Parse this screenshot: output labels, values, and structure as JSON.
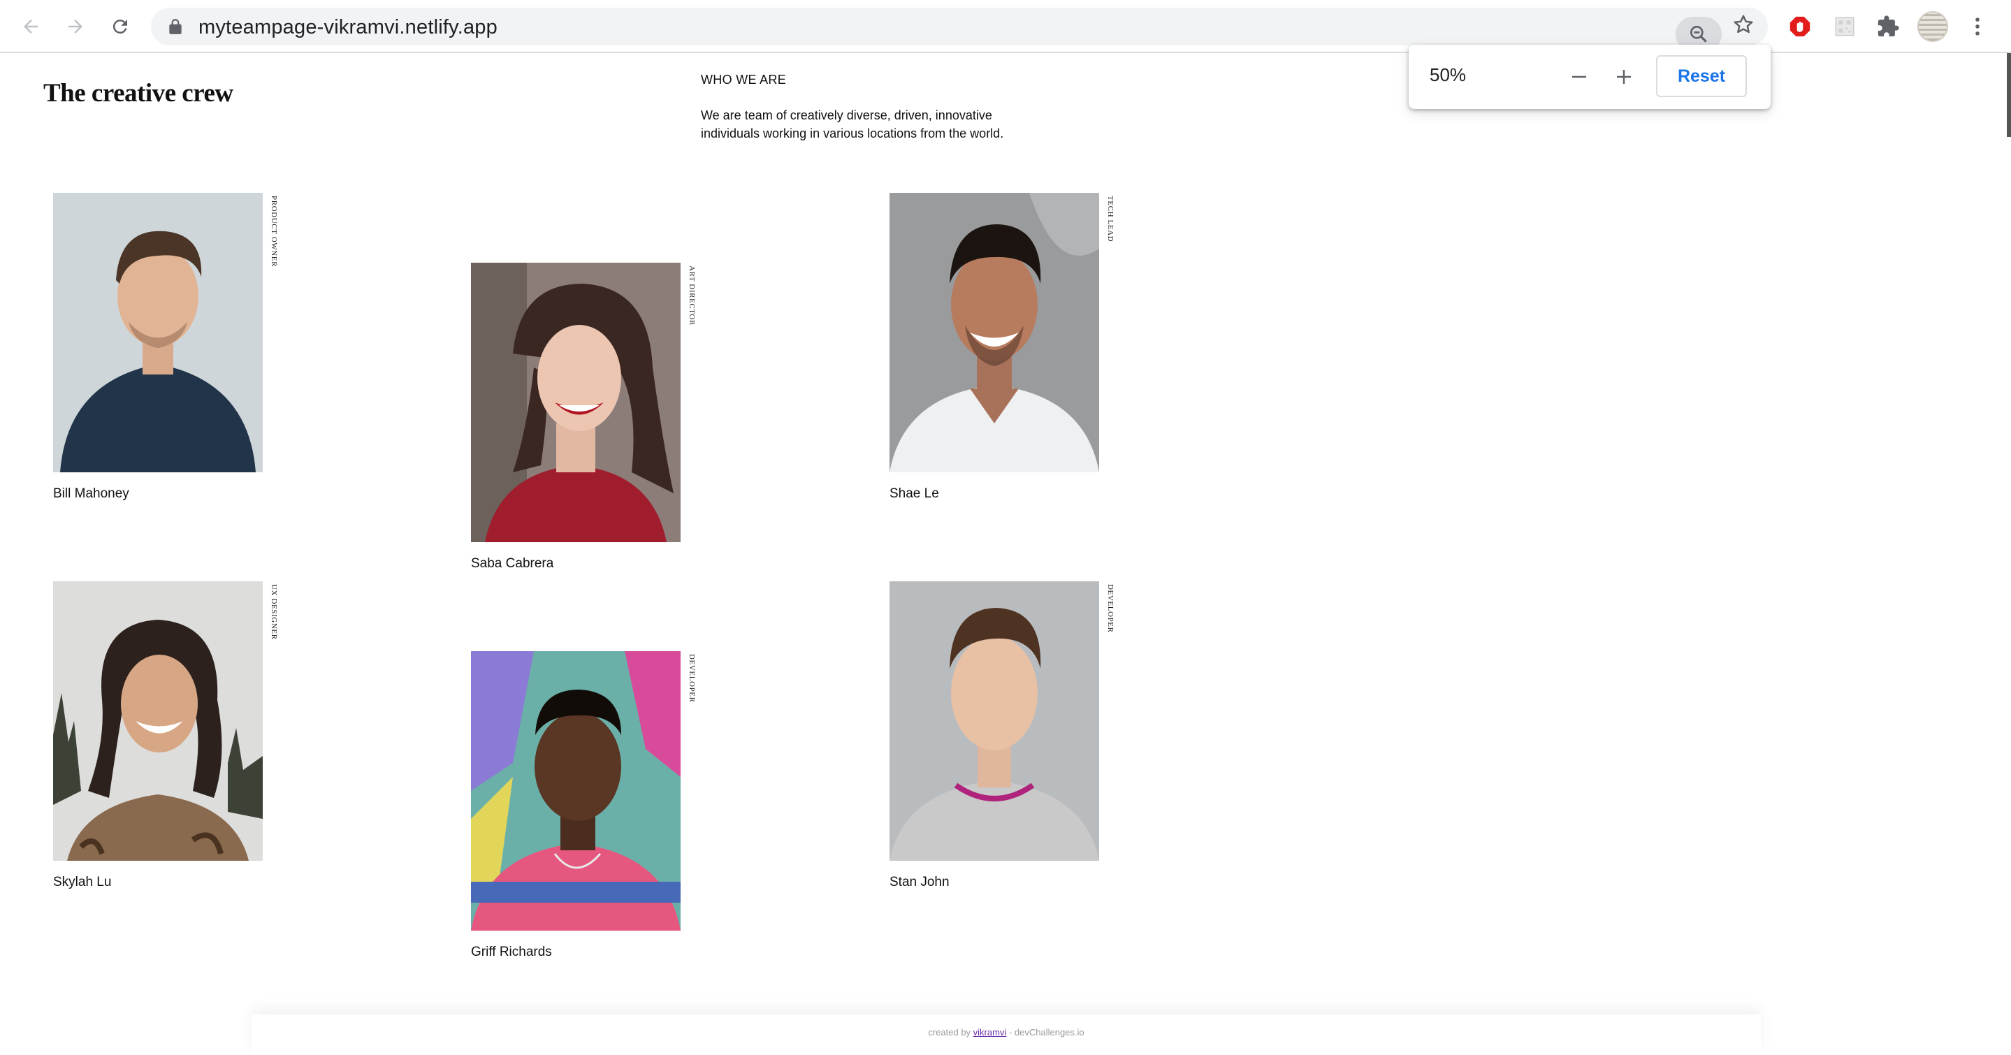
{
  "browser": {
    "url": "myteampage-vikramvi.netlify.app",
    "zoom_popup": {
      "value": "50%",
      "reset_label": "Reset"
    }
  },
  "page": {
    "title": "The creative crew",
    "who_heading": "WHO WE ARE",
    "who_text": "We are team of creatively diverse, driven, innovative individuals working in various locations from the world."
  },
  "members": [
    {
      "name": "Bill Mahoney",
      "role": "PRODUCT OWNER"
    },
    {
      "name": "Saba Cabrera",
      "role": "ART DIRECTOR"
    },
    {
      "name": "Shae Le",
      "role": "TECH LEAD"
    },
    {
      "name": "Skylah Lu",
      "role": "UX DESIGNER"
    },
    {
      "name": "Griff Richards",
      "role": "DEVELOPER"
    },
    {
      "name": "Stan John",
      "role": "DEVELOPER"
    }
  ],
  "footer": {
    "prefix": "created by",
    "author": "vikramvi",
    "suffix": "- devChallenges.io"
  },
  "colors": {
    "link_blue": "#1a73e8",
    "adblock_red": "#e21b1b"
  }
}
